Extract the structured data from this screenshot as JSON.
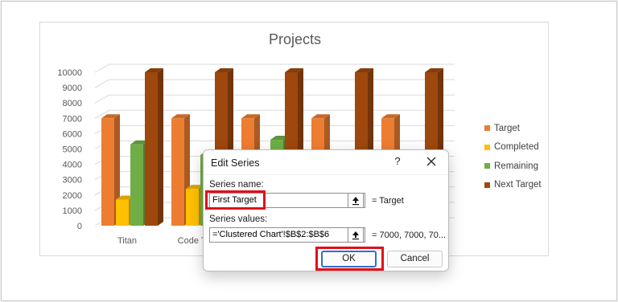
{
  "chart_data": {
    "type": "bar",
    "title": "Projects",
    "categories": [
      "Titan",
      "Code Talk",
      "",
      "",
      ""
    ],
    "ylim": [
      0,
      10000
    ],
    "yticks": [
      0,
      1000,
      2000,
      3000,
      4000,
      5000,
      6000,
      7000,
      8000,
      9000,
      10000
    ],
    "legend_position": "right",
    "series": [
      {
        "name": "Target",
        "values": [
          7000,
          7000,
          7000,
          7000,
          7000
        ]
      },
      {
        "name": "Completed",
        "values": [
          1700,
          2400,
          null,
          null,
          null
        ]
      },
      {
        "name": "Remaining",
        "values": [
          5300,
          4600,
          5600,
          null,
          null
        ]
      },
      {
        "name": "Next Target",
        "values": [
          10000,
          10000,
          10000,
          10000,
          10000
        ]
      }
    ],
    "colors": [
      "#ed7d31",
      "#ffc000",
      "#70ad47",
      "#9e480e"
    ]
  },
  "dialog": {
    "title": "Edit Series",
    "help": "?",
    "series_name_label": "Series name:",
    "series_name_value": "First Target",
    "series_name_result": "= Target",
    "series_values_label": "Series values:",
    "series_values_value": "='Clustered Chart'!$B$2:$B$6",
    "series_values_result": "= 7000, 7000, 70...",
    "ok_label": "OK",
    "cancel_label": "Cancel",
    "collapse_icon": "collapse-dialog-icon",
    "close_icon": "close-icon"
  }
}
